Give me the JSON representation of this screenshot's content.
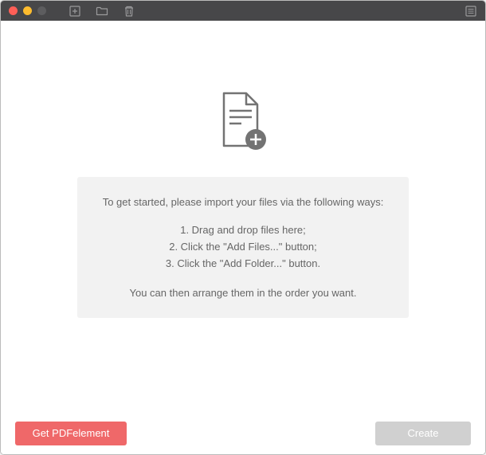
{
  "instructions": {
    "intro": "To get started, please import your files via the following ways:",
    "items": [
      "1. Drag and drop files here;",
      "2. Click the \"Add Files...\" button;",
      "3. Click the \"Add Folder...\" button."
    ],
    "outro": "You can then arrange them in the order you want."
  },
  "footer": {
    "get_pdfelement_label": "Get PDFelement",
    "create_label": "Create"
  }
}
